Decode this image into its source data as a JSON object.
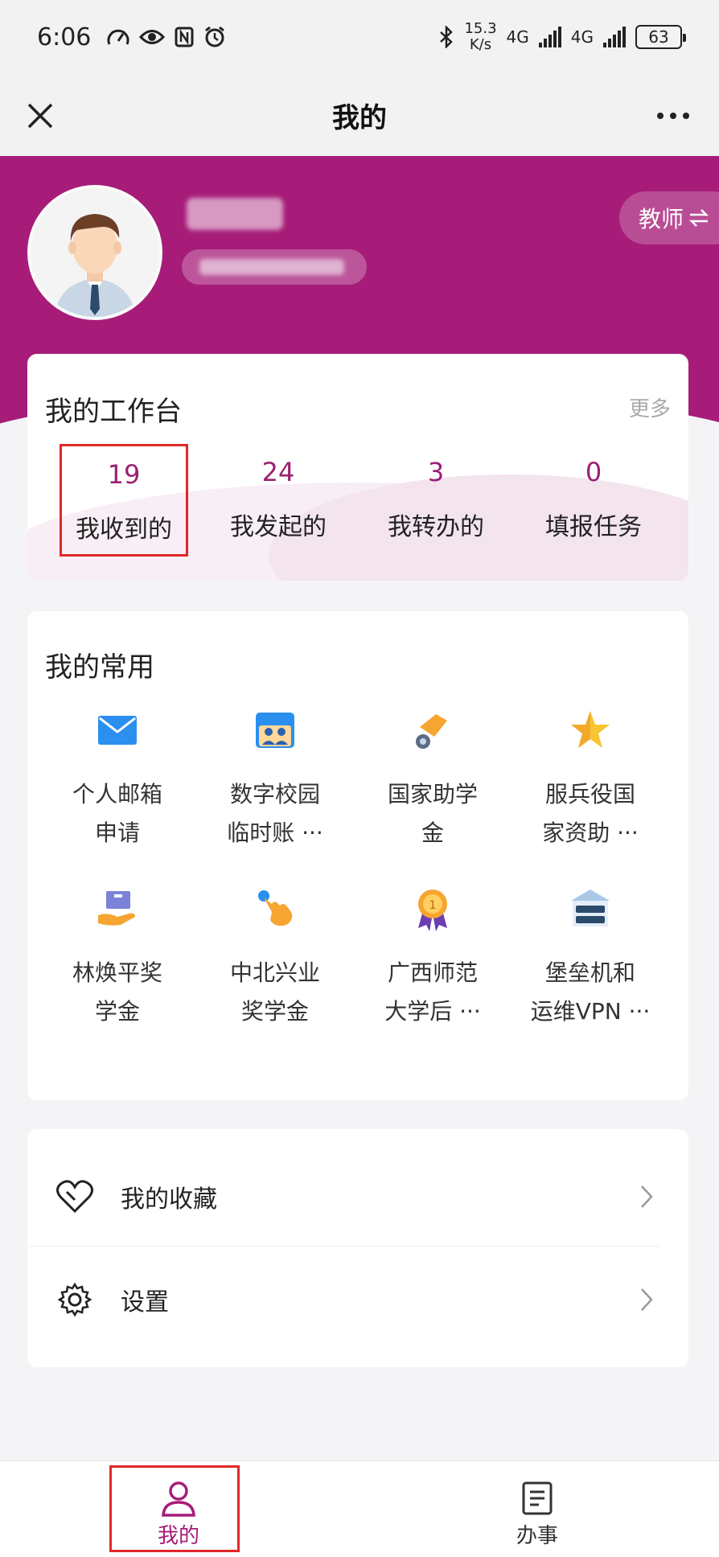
{
  "status": {
    "time": "6:06",
    "speed_value": "15.3",
    "speed_unit": "K/s",
    "net1": "4G",
    "net2": "4G",
    "battery": "63"
  },
  "header": {
    "title": "我的"
  },
  "profile": {
    "role_label": "教师"
  },
  "workbench": {
    "title": "我的工作台",
    "more": "更多",
    "stats": [
      {
        "count": "19",
        "label": "我收到的"
      },
      {
        "count": "24",
        "label": "我发起的"
      },
      {
        "count": "3",
        "label": "我转办的"
      },
      {
        "count": "0",
        "label": "填报任务"
      }
    ]
  },
  "common": {
    "title": "我的常用",
    "apps": [
      {
        "line1": "个人邮箱",
        "line2": "申请",
        "icon": "mail-icon"
      },
      {
        "line1": "数字校园",
        "line2": "临时账 ···",
        "icon": "people-card-icon"
      },
      {
        "line1": "国家助学",
        "line2": "金",
        "icon": "coin-hand-icon"
      },
      {
        "line1": "服兵役国",
        "line2": "家资助 ···",
        "icon": "star-icon"
      },
      {
        "line1": "林焕平奖",
        "line2": "学金",
        "icon": "box-hand-icon"
      },
      {
        "line1": "中北兴业",
        "line2": "奖学金",
        "icon": "pointer-hand-icon"
      },
      {
        "line1": "广西师范",
        "line2": "大学后 ···",
        "icon": "medal-icon"
      },
      {
        "line1": "堡垒机和",
        "line2": "运维VPN ···",
        "icon": "server-icon"
      }
    ]
  },
  "list": {
    "favorites": "我的收藏",
    "settings": "设置"
  },
  "nav": {
    "mine": "我的",
    "tasks": "办事"
  },
  "colors": {
    "brand": "#a61c78",
    "stat_number": "#9c1f74",
    "highlight": "#e02828"
  }
}
